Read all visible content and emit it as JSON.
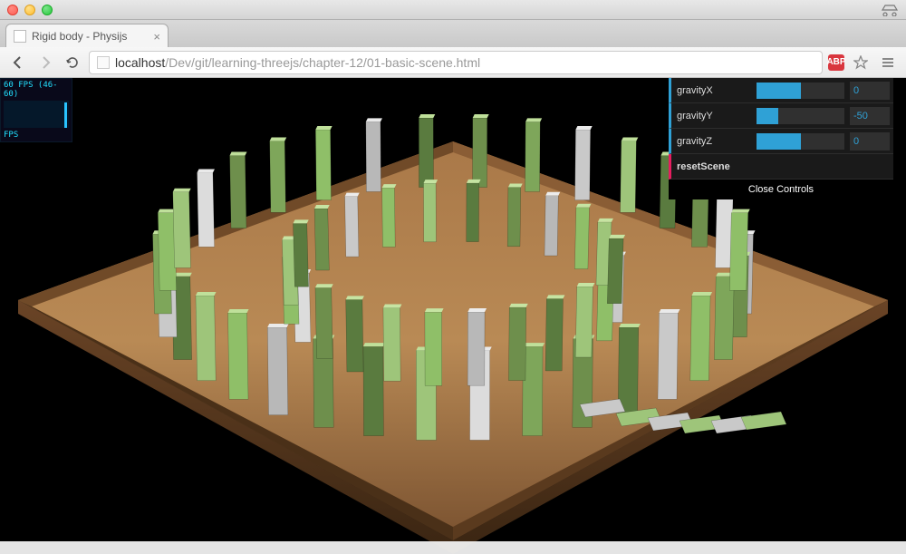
{
  "window": {
    "tab_title": "Rigid body - Physijs"
  },
  "toolbar": {
    "url_host": "localhost",
    "url_path": "/Dev/git/learning-threejs/chapter-12/01-basic-scene.html",
    "ext_abp": "ABP"
  },
  "stats": {
    "fps_line": "60 FPS (46-60)",
    "fps_label": "FPS"
  },
  "gui": {
    "controls": [
      {
        "label": "gravityX",
        "value": "0",
        "fill_pct": 50
      },
      {
        "label": "gravityY",
        "value": "-50",
        "fill_pct": 25
      },
      {
        "label": "gravityZ",
        "value": "0",
        "fill_pct": 50
      }
    ],
    "function_label": "resetScene",
    "close_label": "Close Controls"
  }
}
